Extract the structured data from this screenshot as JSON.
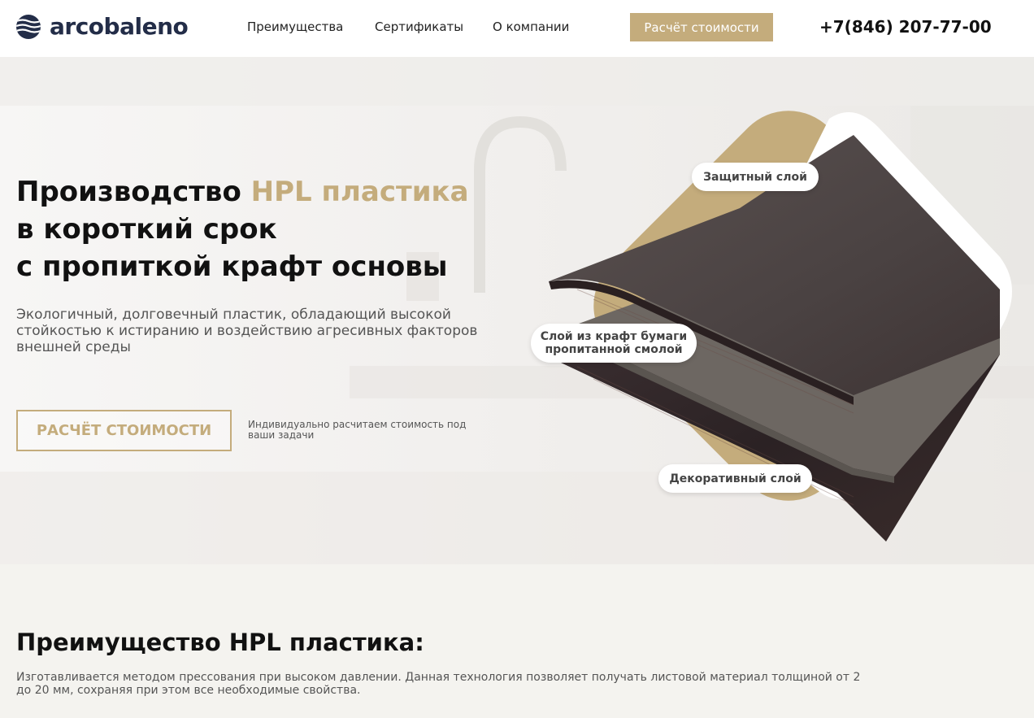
{
  "header": {
    "logo_text": "arcobaleno",
    "nav": [
      "Преимущества",
      "Сертификаты",
      "О компании"
    ],
    "cta_label": "Расчёт стоимости",
    "phone": "+7(846) 207-77-00"
  },
  "hero": {
    "title_part1": "Производство ",
    "title_accent": "HPL пластика",
    "title_part2": " в короткий срок",
    "title_line3": "с пропиткой крафт основы",
    "subtitle": "Экологичный, долговечный пластик, обладающий высокой стойкостью к истиранию и воздействию агресивных факторов внешней среды",
    "button_label": "РАСЧЁТ СТОИМОСТИ",
    "button_note": "Индивидуально расчитаем стоимость под ваши задачи",
    "layers": {
      "top": "Защитный слой",
      "middle": "Слой из крафт бумаги пропитанной смолой",
      "bottom": "Декоративный слой"
    }
  },
  "advantages": {
    "title": "Преимущество HPL пластика:",
    "text": "Изготавливается методом прессования при высоком давлении. Данная технология позволяет получать листовой материал толщиной от 2 до 20 мм, сохраняя при этом все необходимые свойства."
  },
  "colors": {
    "accent": "#c4ac7c",
    "dark": "#232d48",
    "section_bg": "#f4f3ef"
  }
}
